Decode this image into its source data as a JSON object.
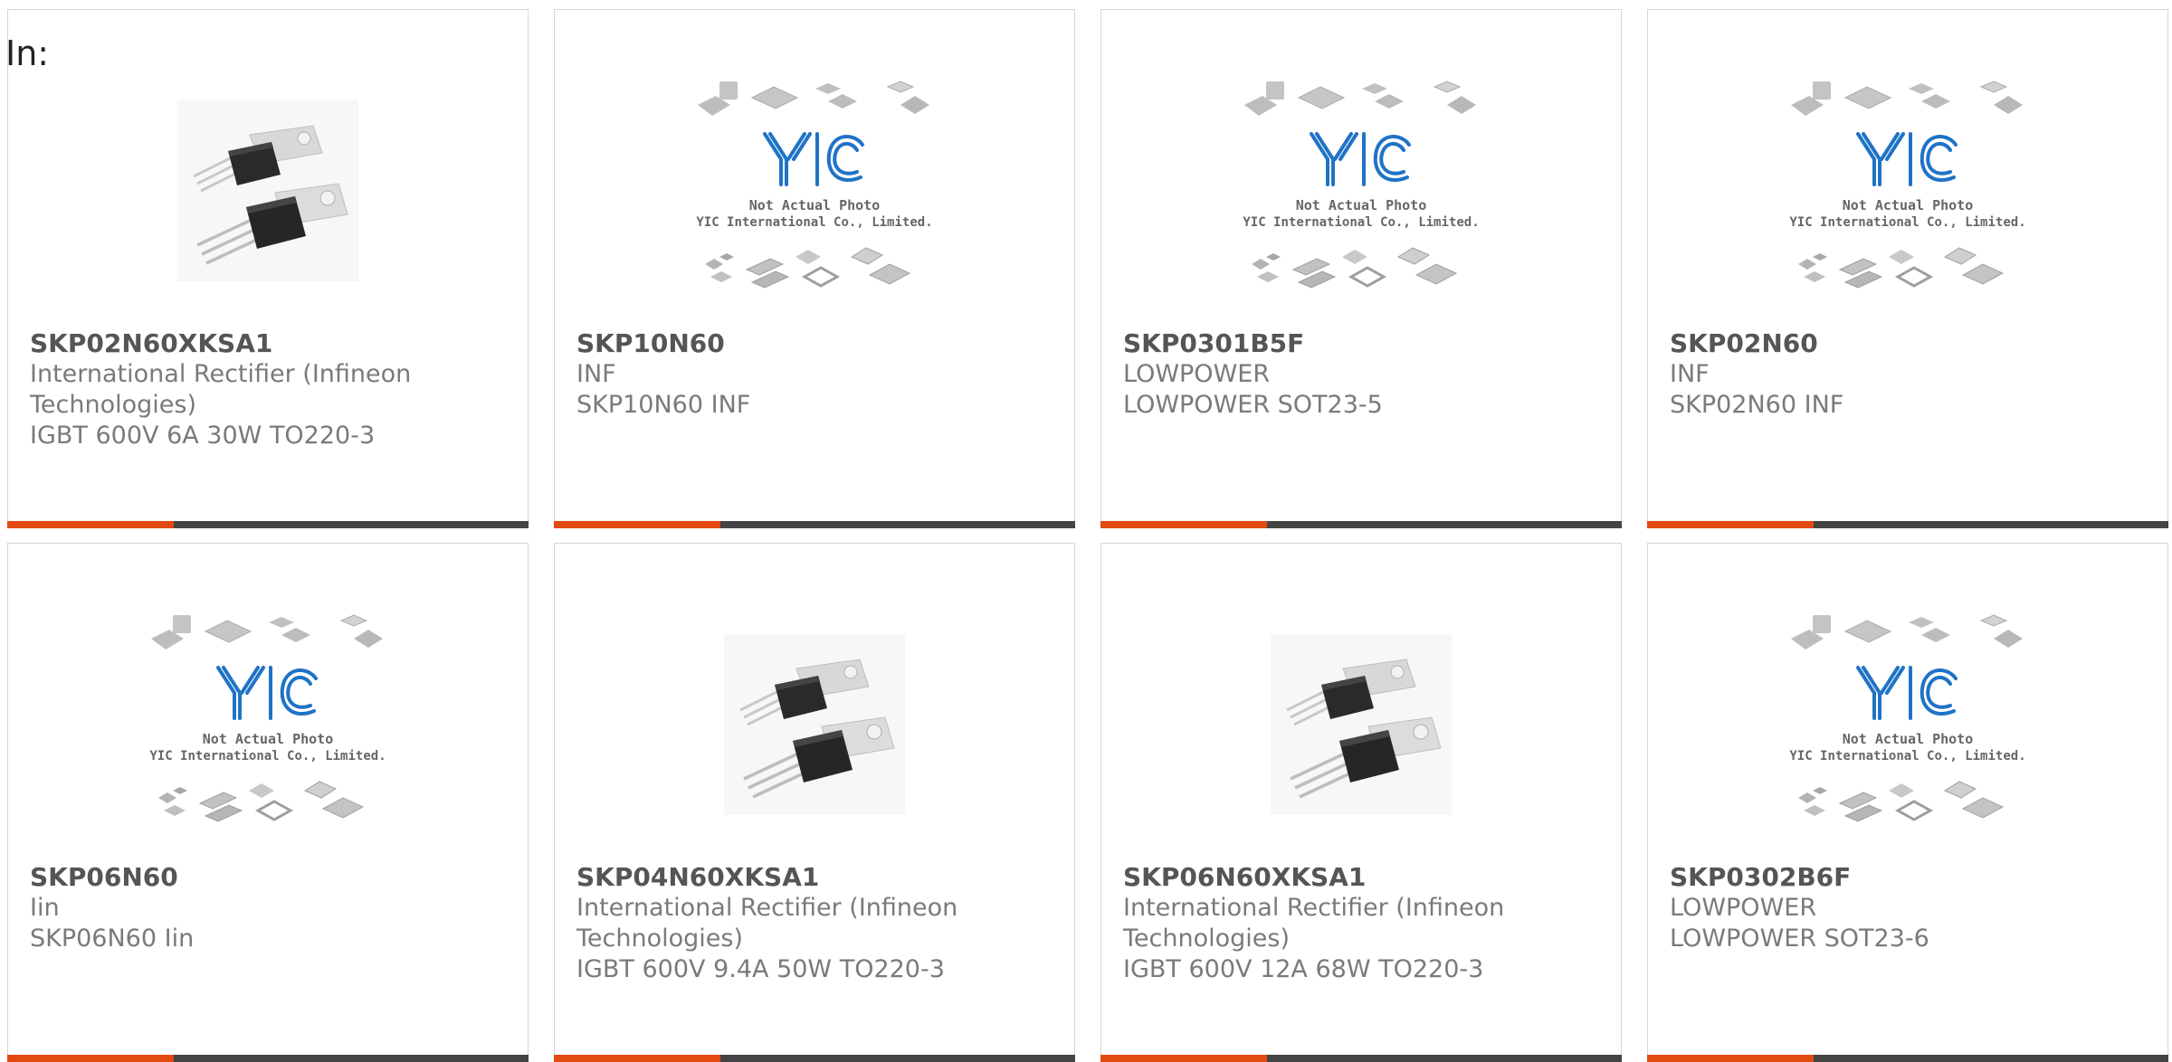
{
  "header": {
    "filter_label": "In:"
  },
  "colors": {
    "accent": "#e24a12",
    "bar": "#444444",
    "border": "#d6d6d6",
    "text_bold": "#555555",
    "text_muted": "#7a7a7a"
  },
  "placeholder": {
    "brand": "YIC",
    "line1": "Not Actual Photo",
    "line2": "YIC International Co., Limited."
  },
  "products": [
    {
      "part_number": "SKP02N60XKSA1",
      "manufacturer": "International Rectifier (Infineon Technologies)",
      "description": "IGBT 600V 6A 30W TO220-3",
      "image": "to220-photo"
    },
    {
      "part_number": "SKP10N60",
      "manufacturer": "INF",
      "description": "SKP10N60 INF",
      "image": "yic-placeholder"
    },
    {
      "part_number": "SKP0301B5F",
      "manufacturer": "LOWPOWER",
      "description": "LOWPOWER SOT23-5",
      "image": "yic-placeholder"
    },
    {
      "part_number": "SKP02N60",
      "manufacturer": "INF",
      "description": "SKP02N60 INF",
      "image": "yic-placeholder"
    },
    {
      "part_number": "SKP06N60",
      "manufacturer": "Iin",
      "description": "SKP06N60 Iin",
      "image": "yic-placeholder"
    },
    {
      "part_number": "SKP04N60XKSA1",
      "manufacturer": "International Rectifier (Infineon Technologies)",
      "description": "IGBT 600V 9.4A 50W TO220-3",
      "image": "to220-photo"
    },
    {
      "part_number": "SKP06N60XKSA1",
      "manufacturer": "International Rectifier (Infineon Technologies)",
      "description": "IGBT 600V 12A 68W TO220-3",
      "image": "to220-photo"
    },
    {
      "part_number": "SKP0302B6F",
      "manufacturer": "LOWPOWER",
      "description": "LOWPOWER SOT23-6",
      "image": "yic-placeholder"
    }
  ]
}
